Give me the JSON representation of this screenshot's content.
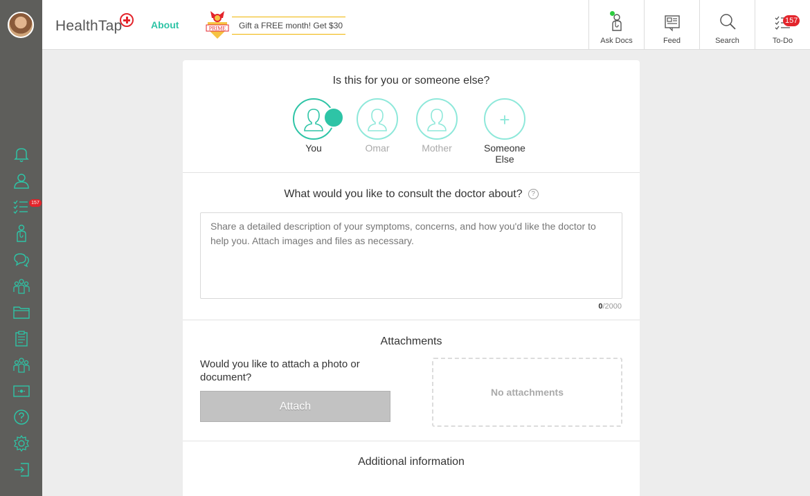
{
  "header": {
    "logo_text": "HealthTap",
    "about_label": "About",
    "prime_label": "PRIME",
    "gift_text": "Gift a FREE month! Get $30",
    "nav": [
      {
        "label": "Ask Docs",
        "icon": "doctor-icon"
      },
      {
        "label": "Feed",
        "icon": "newspaper-icon"
      },
      {
        "label": "Search",
        "icon": "search-icon"
      },
      {
        "label": "To-Do",
        "icon": "checklist-icon",
        "badge": "157"
      }
    ]
  },
  "sidebar": {
    "todo_badge": "157",
    "items": [
      {
        "icon": "bell-icon"
      },
      {
        "icon": "profile-icon"
      },
      {
        "icon": "checklist-icon"
      },
      {
        "icon": "doctor-icon"
      },
      {
        "icon": "chat-icon"
      },
      {
        "icon": "group-icon"
      },
      {
        "icon": "folder-icon"
      },
      {
        "icon": "clipboard-icon"
      },
      {
        "icon": "community-icon"
      },
      {
        "icon": "card-icon"
      },
      {
        "icon": "help-icon"
      },
      {
        "icon": "settings-icon"
      },
      {
        "icon": "logout-icon"
      }
    ]
  },
  "who": {
    "title": "Is this for you or someone else?",
    "people": [
      {
        "name": "You",
        "selected": true
      },
      {
        "name": "Omar",
        "selected": false
      },
      {
        "name": "Mother",
        "selected": false
      },
      {
        "name": "Someone Else",
        "selected": false
      }
    ]
  },
  "consult": {
    "title": "What would you like to consult the doctor about?",
    "help": "?",
    "placeholder": "Share a detailed description of your symptoms, concerns, and how you'd like the doctor to help you. Attach images and files as necessary.",
    "value": "",
    "count": "0",
    "max": "/2000"
  },
  "attachments": {
    "title": "Attachments",
    "question": "Would you like to attach a photo or document?",
    "button_label": "Attach",
    "empty_text": "No attachments"
  },
  "additional": {
    "title": "Additional information"
  },
  "colors": {
    "accent": "#2ec4a6",
    "accent_light": "#8ee8da",
    "sidebar_bg": "#5e5e5b",
    "badge_red": "#e3242b",
    "gift_border": "#f0b400"
  }
}
